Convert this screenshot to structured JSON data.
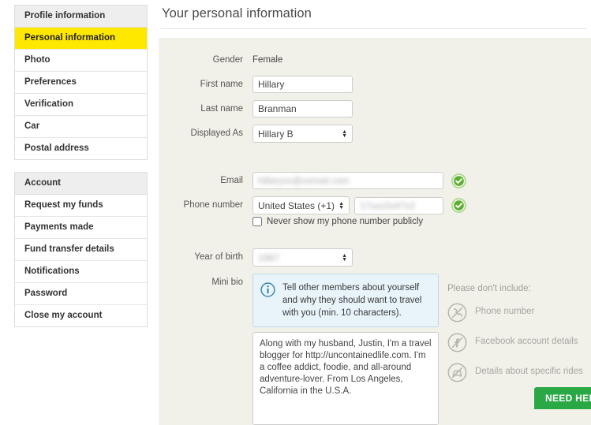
{
  "sidebar": {
    "groups": [
      {
        "header": "Profile information",
        "items": [
          {
            "label": "Personal information",
            "active": true
          },
          {
            "label": "Photo",
            "active": false
          },
          {
            "label": "Preferences",
            "active": false
          },
          {
            "label": "Verification",
            "active": false
          },
          {
            "label": "Car",
            "active": false
          },
          {
            "label": "Postal address",
            "active": false
          }
        ]
      },
      {
        "header": "Account",
        "items": [
          {
            "label": "Request my funds",
            "active": false
          },
          {
            "label": "Payments made",
            "active": false
          },
          {
            "label": "Fund transfer details",
            "active": false
          },
          {
            "label": "Notifications",
            "active": false
          },
          {
            "label": "Password",
            "active": false
          },
          {
            "label": "Close my account",
            "active": false
          }
        ]
      }
    ]
  },
  "main": {
    "title": "Your personal information",
    "labels": {
      "gender": "Gender",
      "first_name": "First name",
      "last_name": "Last name",
      "displayed_as": "Displayed As",
      "email": "Email",
      "phone_number": "Phone number",
      "year_of_birth": "Year of birth",
      "mini_bio": "Mini bio"
    },
    "values": {
      "gender": "Female",
      "first_name": "Hillary",
      "last_name": "Branman",
      "displayed_as": "Hillary B",
      "email_redacted": "hillaryxx@xxmail.com",
      "phone_country": "United States (+1)",
      "phone_redacted": "17xxx2x47x2",
      "year_of_birth_redacted": "1987",
      "bio": "Along with my husband, Justin, I'm a travel blogger for http://uncontainedlife.com. I'm a coffee addict, foodie, and all-around adventure-lover. From Los Angeles, California in the U.S.A."
    },
    "checkbox": {
      "never_show_phone": "Never show my phone number publicly",
      "checked": false
    },
    "info_box": {
      "text": "Tell other members about yourself and why they should want to travel with you (min. 10 characters)."
    },
    "dont_include": {
      "title": "Please don't include:",
      "items": [
        {
          "label": "Phone number",
          "icon": "no-phone-icon"
        },
        {
          "label": "Facebook account details",
          "icon": "no-facebook-icon"
        },
        {
          "label": "Details about specific rides",
          "icon": "no-rides-icon"
        }
      ]
    },
    "email_verified_icon": "verified-check-icon",
    "phone_verified_icon": "verified-check-icon"
  },
  "help": {
    "label": "NEED HELP"
  },
  "colors": {
    "accent_yellow": "#ffe800",
    "panel_beige": "#f2f1e9",
    "info_blue": "#e8f4fa",
    "verified_green": "#6cba3a",
    "help_green": "#2aa845"
  }
}
